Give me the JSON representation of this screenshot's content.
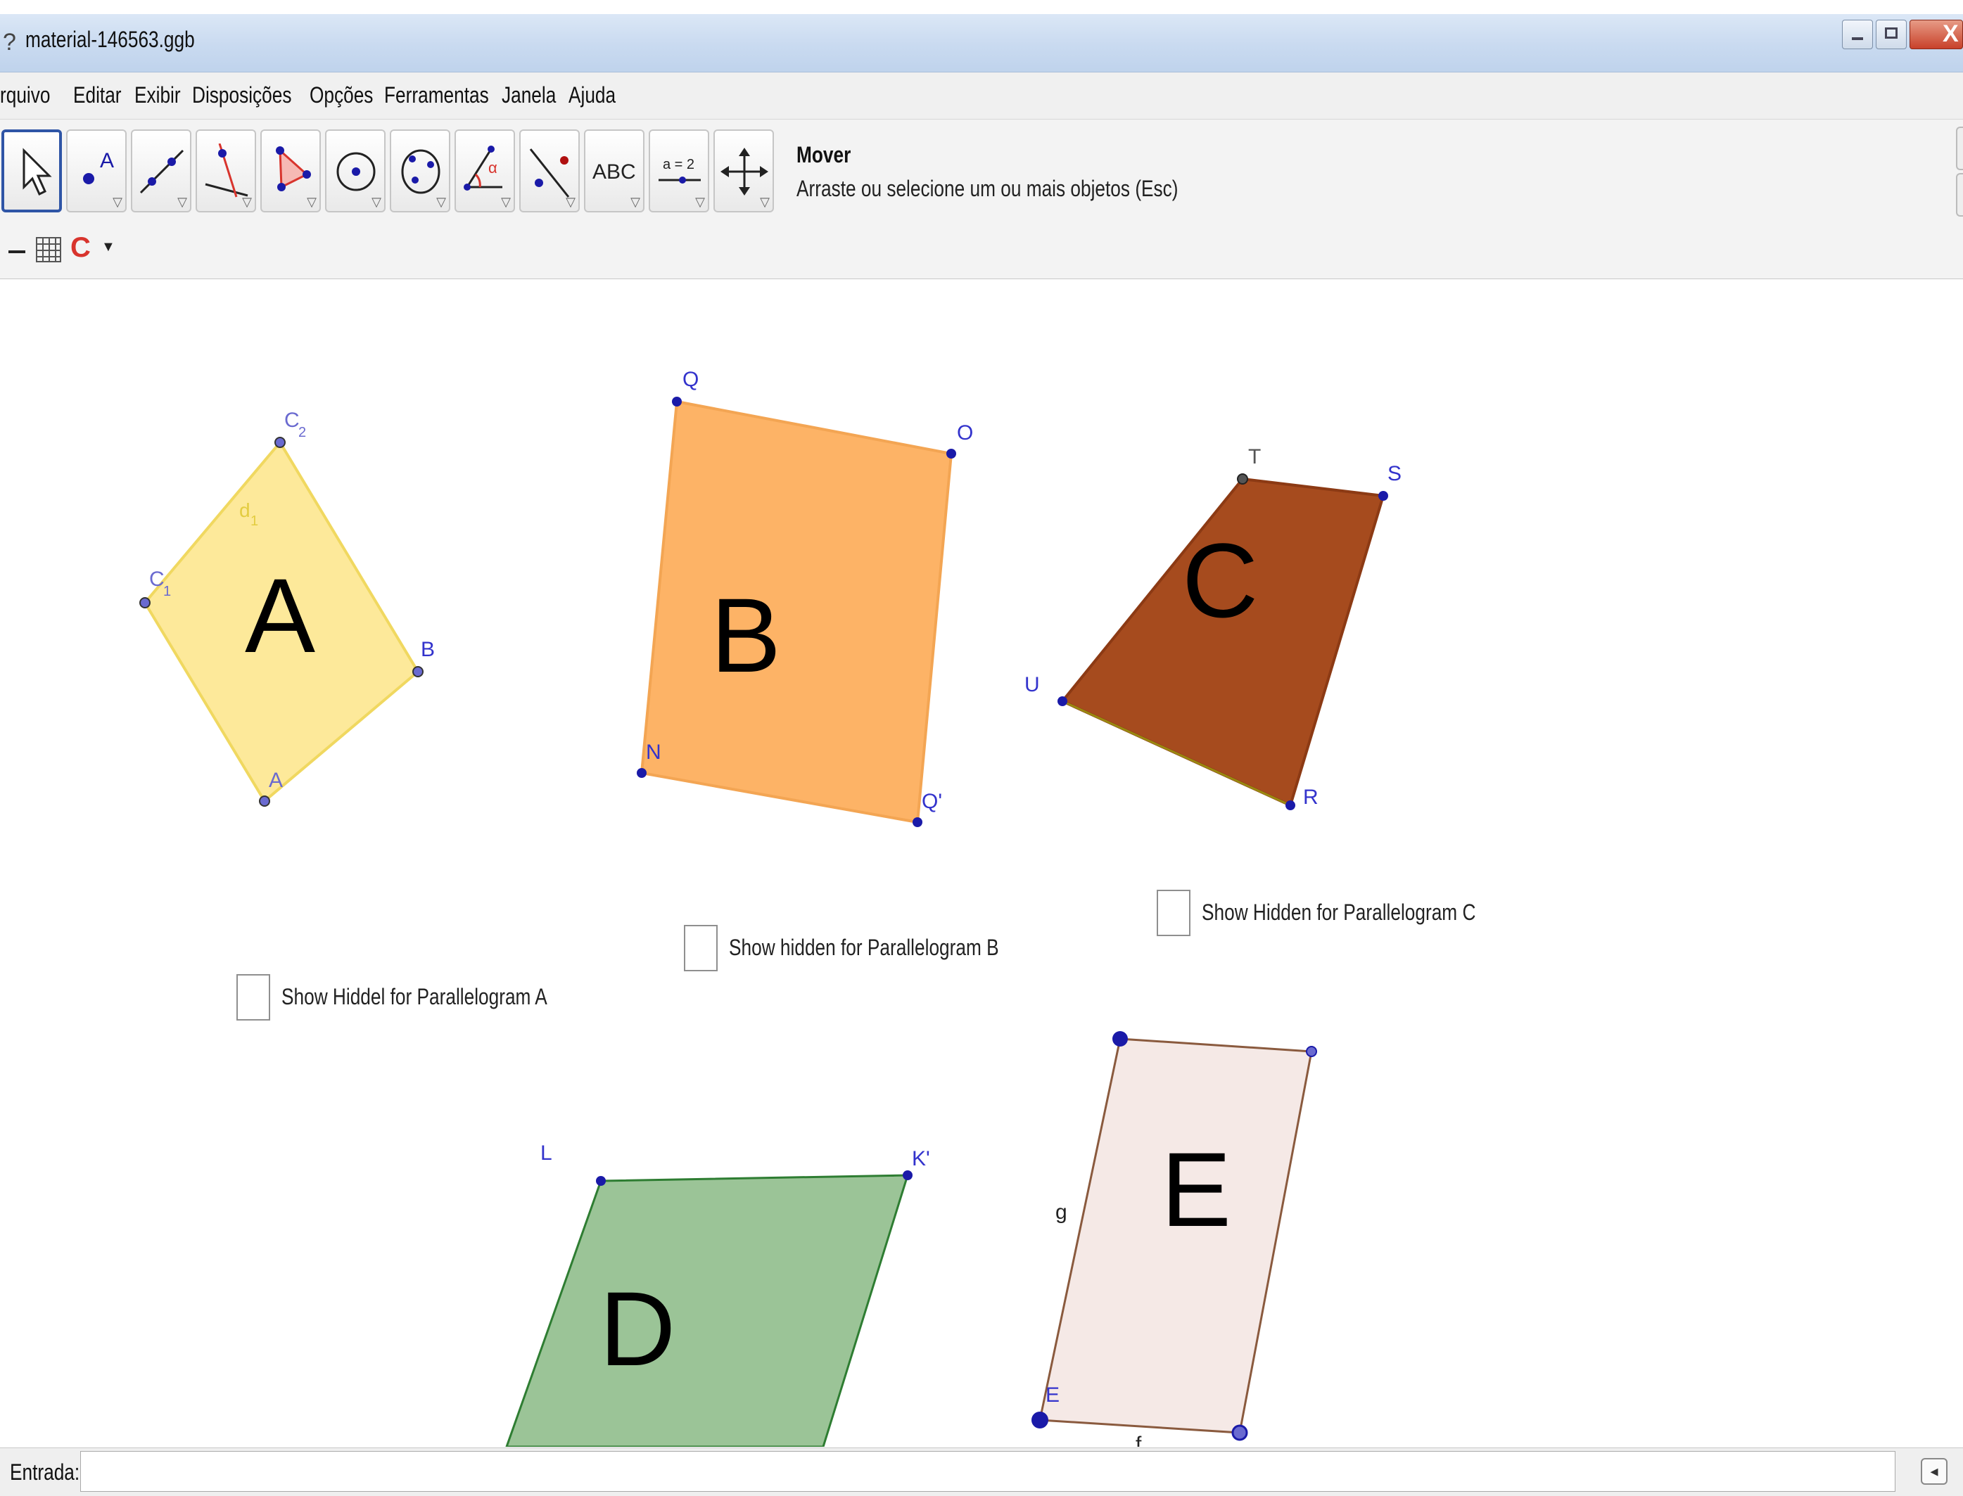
{
  "window": {
    "title": "material-146563.ggb",
    "app_icon": "geogebra-icon",
    "controls": [
      "minimize-icon",
      "maximize-icon",
      "close-icon"
    ]
  },
  "menu": {
    "items": [
      "rquivo",
      "Editar",
      "Exibir",
      "Disposições",
      "Opções",
      "Ferramentas",
      "Janela",
      "Ajuda"
    ]
  },
  "toolbar": {
    "tools": [
      {
        "icon": "move-pointer-icon",
        "active": true
      },
      {
        "icon": "point-icon",
        "text": "A"
      },
      {
        "icon": "line-through-two-points-icon"
      },
      {
        "icon": "perpendicular-line-icon"
      },
      {
        "icon": "polygon-icon"
      },
      {
        "icon": "circle-center-point-icon"
      },
      {
        "icon": "conic-five-points-icon"
      },
      {
        "icon": "angle-icon",
        "text": "α"
      },
      {
        "icon": "reflect-about-line-icon"
      },
      {
        "icon": "text-tool-icon",
        "text": "ABC"
      },
      {
        "icon": "slider-icon",
        "text": "a = 2"
      },
      {
        "icon": "move-graphics-view-icon"
      }
    ],
    "help_name": "Mover",
    "help_description": "Arraste ou selecione um ou mais objetos (Esc)"
  },
  "stylebar": {
    "icons": [
      "axes-toggle-icon",
      "grid-toggle-icon",
      "color-c-icon",
      "chevron-down-icon"
    ],
    "colors": {
      "icon_red": "#d8342d"
    }
  },
  "graphics": {
    "shapes": {
      "A": {
        "big_label": "A",
        "fill": "#fde99a",
        "edge": "#f0d860",
        "vertex_labels": [
          "C",
          "2",
          "C",
          "1",
          "B",
          "A"
        ],
        "segment_label": {
          "main": "d",
          "sub": "1"
        }
      },
      "B": {
        "big_label": "B",
        "fill": "#fdb366",
        "edge": "#f3a553",
        "vertex_labels": [
          "Q",
          "O",
          "N",
          "Q'"
        ]
      },
      "C": {
        "big_label": "C",
        "fill": "#a64b1e",
        "edge": "#8c3a14",
        "vertex_labels": [
          "T",
          "S",
          "U",
          "R"
        ]
      },
      "D": {
        "big_label": "D",
        "fill": "#9bc497",
        "edge": "#2e7d32",
        "vertex_labels": [
          "L",
          "K'"
        ]
      },
      "E": {
        "big_label": "E",
        "fill": "#f5e9e6",
        "edge": "#8a5a3e",
        "vertex_labels": [
          "E"
        ],
        "side_label": "g",
        "partial_label": "f"
      }
    },
    "checkboxes": [
      {
        "label": "Show Hiddel for Parallelogram A",
        "checked": false
      },
      {
        "label": "Show hidden for Parallelogram  B",
        "checked": false
      },
      {
        "label": "Show Hidden for Parallelogram  C",
        "checked": false
      }
    ],
    "point_color": "#1a1aa8",
    "label_color": "#3333cc"
  },
  "input_bar": {
    "label": "Entrada:",
    "value": "",
    "help_icon": "input-help-icon"
  }
}
